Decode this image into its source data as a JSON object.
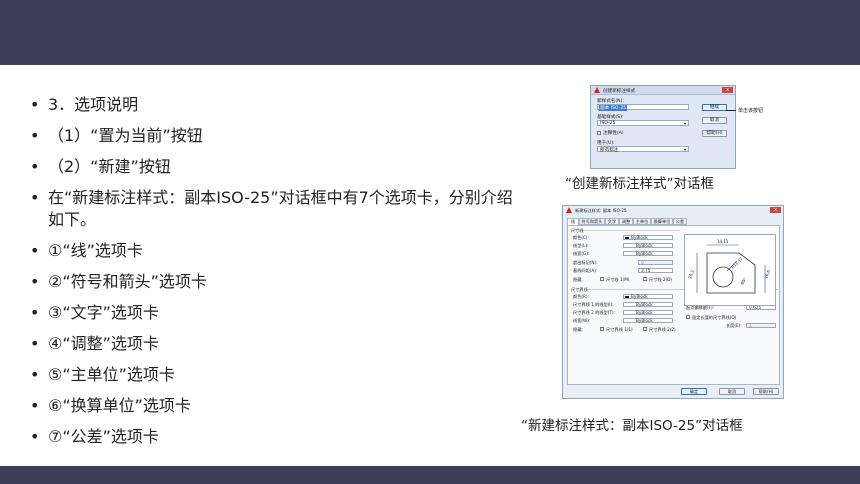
{
  "bullets": [
    "3．选项说明",
    "（1）“置为当前”按钮",
    "（2）“新建”按钮",
    "在“新建标注样式：副本ISO-25”对话框中有7个选项卡，分别介绍如下。",
    "①“线”选项卡",
    "②“符号和箭头”选项卡",
    "③“文字”选项卡",
    "④“调整”选项卡",
    "⑤“主单位”选项卡",
    "⑥“换算单位”选项卡",
    "⑦“公差”选项卡"
  ],
  "bullet_glyph": "•",
  "captions": {
    "dialog1": "“创建新标注样式”对话框",
    "dialog2": "“新建标注样式：副本ISO-25”对话框"
  },
  "colors": {
    "bar": "#3e3d5a",
    "logo": "#d61f1f"
  },
  "dialog1": {
    "title": "创建新标注样式",
    "close": "x",
    "new_style_label": "新样式名(N):",
    "new_style_value": "副本 ISO-25",
    "base_style_label": "基础样式(S):",
    "base_style_value": "ISO-25",
    "annotative_label": "注释性(A)",
    "use_for_label": "用于(U):",
    "use_for_value": "所有标注",
    "continue_button": "继续",
    "cancel_button": "取消",
    "help_button": "帮助(H)",
    "callout": "单击该按钮"
  },
  "dialog2": {
    "title": "新建标注样式: 副本 ISO-25",
    "close": "x",
    "tabs": [
      "线",
      "符号和箭头",
      "文字",
      "调整",
      "主单位",
      "换算单位",
      "公差"
    ],
    "dim_lines_group": "尺寸线",
    "dim_color_label": "颜色(C):",
    "dim_color_value": "ByBlock",
    "dim_linetype_label": "线型(L):",
    "dim_linetype_value": "ByBlock",
    "dim_lineweight_label": "线宽(G):",
    "dim_lineweight_value": "ByBlock",
    "extend_ticks_label": "超出标记(N):",
    "extend_ticks_value": "0",
    "baseline_spacing_label": "基线间距(A):",
    "baseline_spacing_value": "3.75",
    "suppress_label": "隐藏:",
    "suppress_dim1": "尺寸线 1(M)",
    "suppress_dim2": "尺寸线 2(D)",
    "ext_lines_group": "尺寸界线",
    "ext_color_label": "颜色(R):",
    "ext_color_value": "ByBlock",
    "ext_linetype1_label": "尺寸界线 1 的线型(I):",
    "ext_linetype1_value": "ByBlock",
    "ext_linetype2_label": "尺寸界线 2 的线型(T):",
    "ext_linetype2_value": "ByBlock",
    "ext_lineweight_label": "线宽(W):",
    "ext_lineweight_value": "ByBlock",
    "ext_suppress_label": "隐藏:",
    "ext_suppress1": "尺寸界线 1(1)",
    "ext_suppress2": "尺寸界线 2(2)",
    "beyond_label": "超出尺寸线(X):",
    "beyond_value": "1.25",
    "offset_label": "起点偏移量(F):",
    "offset_value": "0.625",
    "fixed_length_label": "固定长度的尺寸界线(O)",
    "length_label": "长度(E):",
    "length_value": "1",
    "preview_dims": [
      "14,11",
      "16,6",
      "28,2",
      "R11,17",
      "60°"
    ],
    "ok_button": "确定",
    "cancel_button": "取消",
    "help_button": "帮助(H)"
  }
}
